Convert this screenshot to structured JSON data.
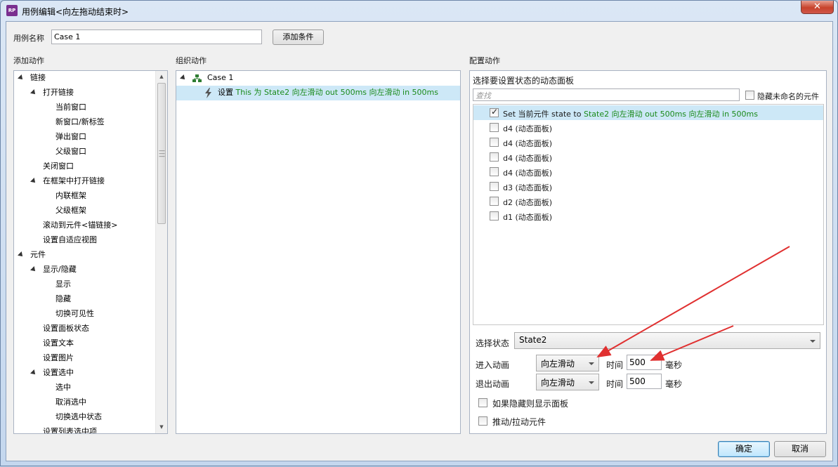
{
  "window": {
    "title": "用例编辑<向左拖动结束时>",
    "app_icon_text": "RP",
    "close_symbol": "✕"
  },
  "case_name": {
    "label": "用例名称",
    "value": "Case 1",
    "add_condition_label": "添加条件"
  },
  "add_action": {
    "header": "添加动作",
    "items": [
      {
        "label": "链接",
        "level": 0,
        "expander": true
      },
      {
        "label": "打开链接",
        "level": 1,
        "expander": true
      },
      {
        "label": "当前窗口",
        "level": 2
      },
      {
        "label": "新窗口/新标签",
        "level": 2
      },
      {
        "label": "弹出窗口",
        "level": 2
      },
      {
        "label": "父级窗口",
        "level": 2
      },
      {
        "label": "关闭窗口",
        "level": 1
      },
      {
        "label": "在框架中打开链接",
        "level": 1,
        "expander": true
      },
      {
        "label": "内联框架",
        "level": 2
      },
      {
        "label": "父级框架",
        "level": 2
      },
      {
        "label": "滚动到元件<锚链接>",
        "level": 1
      },
      {
        "label": "设置自适应视图",
        "level": 1
      },
      {
        "label": "元件",
        "level": 0,
        "expander": true
      },
      {
        "label": "显示/隐藏",
        "level": 1,
        "expander": true
      },
      {
        "label": "显示",
        "level": 2
      },
      {
        "label": "隐藏",
        "level": 2
      },
      {
        "label": "切换可见性",
        "level": 2
      },
      {
        "label": "设置面板状态",
        "level": 1
      },
      {
        "label": "设置文本",
        "level": 1
      },
      {
        "label": "设置图片",
        "level": 1
      },
      {
        "label": "设置选中",
        "level": 1,
        "expander": true
      },
      {
        "label": "选中",
        "level": 2
      },
      {
        "label": "取消选中",
        "level": 2
      },
      {
        "label": "切换选中状态",
        "level": 2
      },
      {
        "label": "设置列表选中项",
        "level": 1
      }
    ]
  },
  "organize": {
    "header": "组织动作",
    "case_label": "Case 1",
    "action_prefix": "设置",
    "action_detail": "This 为 State2 向左滑动 out 500ms 向左滑动 in 500ms"
  },
  "config": {
    "header": "配置动作",
    "panel_title": "选择要设置状态的动态面板",
    "search_placeholder": "查找",
    "hide_unnamed_label": "隐藏未命名的元件",
    "rows": [
      {
        "prefix": "Set 当前元件 state to",
        "detail": "State2 向左滑动 out 500ms 向左滑动 in 500ms",
        "checked": true,
        "selected": true
      },
      {
        "prefix": "d4 (动态面板)",
        "detail": "",
        "checked": false
      },
      {
        "prefix": "d4 (动态面板)",
        "detail": "",
        "checked": false
      },
      {
        "prefix": "d4 (动态面板)",
        "detail": "",
        "checked": false
      },
      {
        "prefix": "d4 (动态面板)",
        "detail": "",
        "checked": false
      },
      {
        "prefix": "d3 (动态面板)",
        "detail": "",
        "checked": false
      },
      {
        "prefix": "d2 (动态面板)",
        "detail": "",
        "checked": false
      },
      {
        "prefix": "d1 (动态面板)",
        "detail": "",
        "checked": false
      }
    ],
    "select_state_label": "选择状态",
    "select_state_value": "State2",
    "enter_anim_label": "进入动画",
    "enter_anim_value": "向左滑动",
    "exit_anim_label": "退出动画",
    "exit_anim_value": "向左滑动",
    "time_label": "时间",
    "enter_time": "500",
    "exit_time": "500",
    "ms_label": "毫秒",
    "show_if_hidden_label": "如果隐藏则显示面板",
    "push_pull_label": "推动/拉动元件"
  },
  "footer": {
    "ok_label": "确定",
    "cancel_label": "取消"
  },
  "colors": {
    "accent_green": "#1a8a1a",
    "selection": "#cde8f7",
    "annotation_red": "#e03030"
  }
}
